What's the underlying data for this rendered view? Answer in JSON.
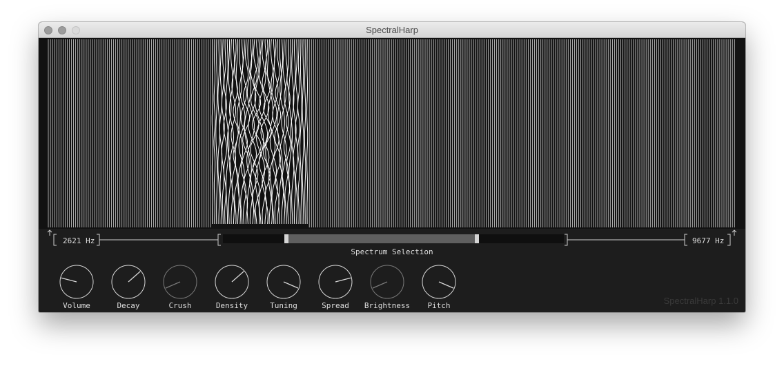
{
  "window": {
    "title": "SpectralHarp"
  },
  "range": {
    "low": "2621 Hz",
    "high": "9677 Hz",
    "caption": "Spectrum Selection",
    "selection_start_fraction": 0.19,
    "selection_end_fraction": 0.74
  },
  "knobs": [
    {
      "label": "Volume",
      "value": 0.22,
      "enabled": true
    },
    {
      "label": "Decay",
      "value": 0.68,
      "enabled": true
    },
    {
      "label": "Crush",
      "value": 0.08,
      "enabled": false
    },
    {
      "label": "Density",
      "value": 0.68,
      "enabled": true
    },
    {
      "label": "Tuning",
      "value": 0.92,
      "enabled": true
    },
    {
      "label": "Spread",
      "value": 0.78,
      "enabled": true
    },
    {
      "label": "Brightness",
      "value": 0.08,
      "enabled": false
    },
    {
      "label": "Pitch",
      "value": 0.92,
      "enabled": true
    }
  ],
  "footer": {
    "version": "SpectralHarp 1.1.0"
  },
  "colors": {
    "background": "#1d1d1d",
    "strings": "#ffffff",
    "text": "#dedede"
  }
}
